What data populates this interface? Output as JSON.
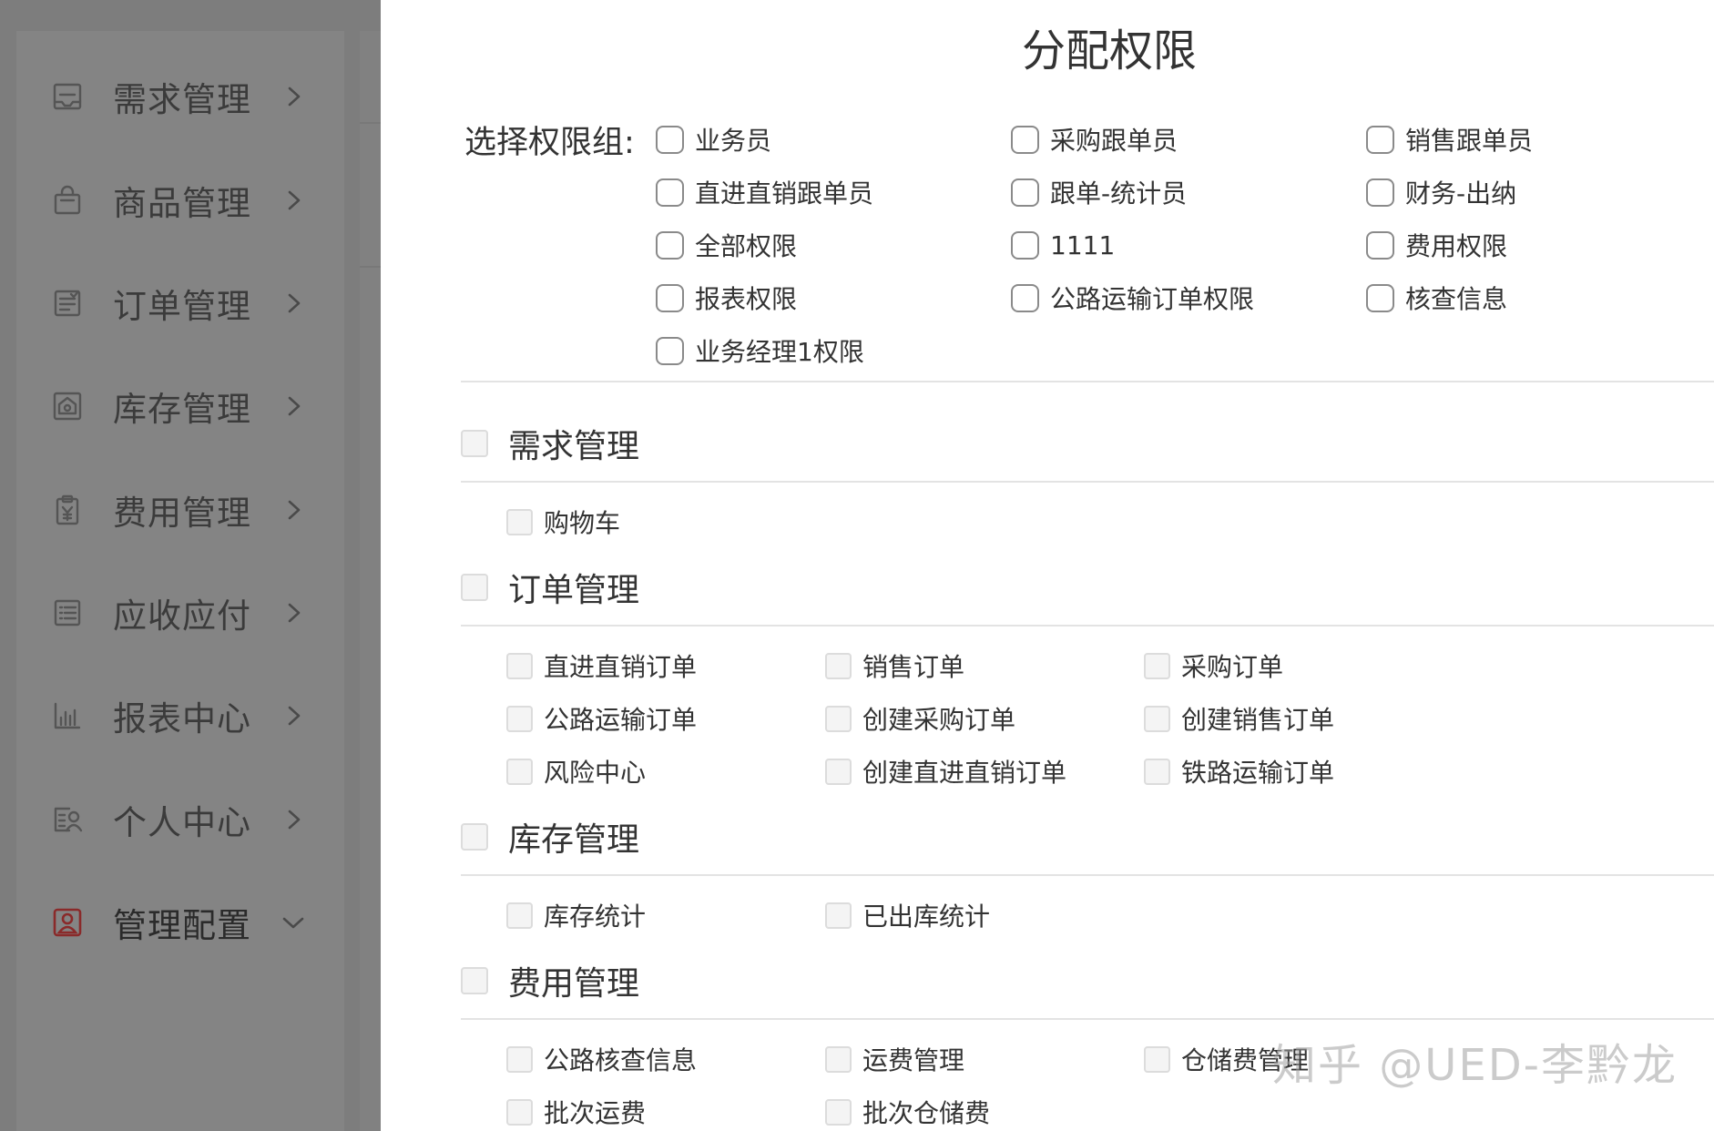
{
  "sidebar": {
    "items": [
      {
        "label": "需求管理",
        "icon": "inbox-icon",
        "arrow": "chevron-right-icon"
      },
      {
        "label": "商品管理",
        "icon": "shopping-bag-icon",
        "arrow": "chevron-right-icon"
      },
      {
        "label": "订单管理",
        "icon": "order-list-icon",
        "arrow": "chevron-right-icon"
      },
      {
        "label": "库存管理",
        "icon": "warehouse-icon",
        "arrow": "chevron-right-icon"
      },
      {
        "label": "费用管理",
        "icon": "yen-clipboard-icon",
        "arrow": "chevron-right-icon"
      },
      {
        "label": "应收应付",
        "icon": "ledger-icon",
        "arrow": "chevron-right-icon"
      },
      {
        "label": "报表中心",
        "icon": "bar-chart-icon",
        "arrow": "chevron-right-icon"
      },
      {
        "label": "个人中心",
        "icon": "profile-card-icon",
        "arrow": "chevron-right-icon"
      },
      {
        "label": "管理配置",
        "icon": "admin-user-icon",
        "arrow": "chevron-down-icon"
      }
    ]
  },
  "drawer": {
    "title": "分配权限",
    "group_label": "选择权限组:",
    "groups": [
      "业务员",
      "采购跟单员",
      "销售跟单员",
      "直进直销跟单员",
      "跟单-统计员",
      "财务-出纳",
      "全部权限",
      "1111",
      "费用权限",
      "报表权限",
      "公路运输订单权限",
      "核查信息",
      "业务经理1权限"
    ],
    "sections": [
      {
        "title": "需求管理",
        "items": [
          "购物车"
        ]
      },
      {
        "title": "订单管理",
        "items": [
          "直进直销订单",
          "销售订单",
          "采购订单",
          "公路运输订单",
          "创建采购订单",
          "创建销售订单",
          "风险中心",
          "创建直进直销订单",
          "铁路运输订单"
        ]
      },
      {
        "title": "库存管理",
        "items": [
          "库存统计",
          "已出库统计"
        ]
      },
      {
        "title": "费用管理",
        "items": [
          "公路核查信息",
          "运费管理",
          "仓储费管理",
          "批次运费",
          "批次仓储费"
        ]
      }
    ]
  },
  "watermark": "知乎 @UED-李黔龙"
}
